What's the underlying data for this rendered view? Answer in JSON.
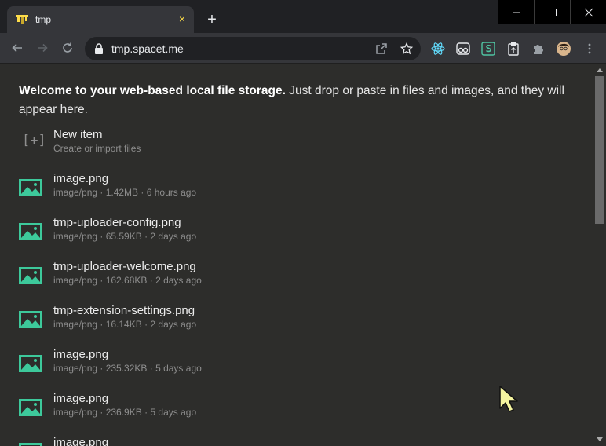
{
  "browser": {
    "tab_title": "tmp",
    "tab_close": "×",
    "new_tab": "+",
    "url": "tmp.spacet.me",
    "accent": "#fddc4a"
  },
  "extensions": [
    "react-devtools-icon",
    "vue-glasses-icon",
    "s-extension-icon",
    "clipboard-icon",
    "puzzle-icon",
    "profile-avatar",
    "more-menu-icon"
  ],
  "page": {
    "welcome_bold": "Welcome to your web-based local file storage.",
    "welcome_rest": " Just drop or paste in files and images, and they will appear here.",
    "new_item": {
      "icon": "[+]",
      "name": "New item",
      "meta": "Create or import files"
    },
    "files": [
      {
        "name": "image.png",
        "meta": "image/png · 1.42MB · 6 hours ago"
      },
      {
        "name": "tmp-uploader-config.png",
        "meta": "image/png · 65.59KB · 2 days ago"
      },
      {
        "name": "tmp-uploader-welcome.png",
        "meta": "image/png · 162.68KB · 2 days ago"
      },
      {
        "name": "tmp-extension-settings.png",
        "meta": "image/png · 16.14KB · 2 days ago"
      },
      {
        "name": "image.png",
        "meta": "image/png · 235.32KB · 5 days ago"
      },
      {
        "name": "image.png",
        "meta": "image/png · 236.9KB · 5 days ago"
      },
      {
        "name": "image.png",
        "meta": ""
      }
    ],
    "image_icon_color": "#3dc99b"
  }
}
